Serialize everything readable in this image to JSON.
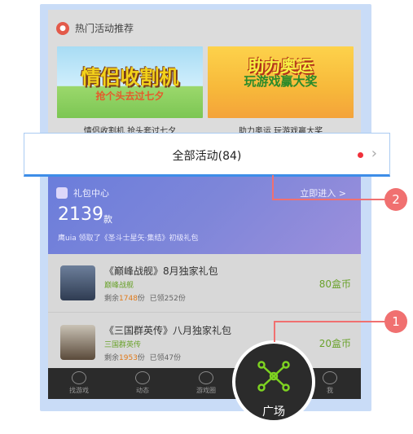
{
  "hot": {
    "title": "热门活动推荐",
    "banners": [
      {
        "art_title": "情侣收割机",
        "art_sub": "抢个头去过七夕",
        "caption": "情侣收割机 抢头套过七夕"
      },
      {
        "art_title": "助力奥运",
        "art_sub": "玩游戏赢大奖",
        "caption": "助力奥运 玩游戏赢大奖"
      }
    ]
  },
  "overlay": {
    "label": "全部活动(84)"
  },
  "gift": {
    "title": "礼包中心",
    "enter_label": "立即进入 >",
    "count": "2139",
    "unit": "款",
    "note": "鹰uia 领取了《圣斗士星矢·集结》初级礼包"
  },
  "games": [
    {
      "title": "《巅峰战舰》8月独家礼包",
      "name": "巅峰战舰",
      "remain_prefix": "剩余",
      "remain": "1748",
      "remain_suffix": "份",
      "claimed": "已领252份",
      "price": "80盒币"
    },
    {
      "title": "《三国群英传》八月独家礼包",
      "name": "三国群英传",
      "remain_prefix": "剩余",
      "remain": "1953",
      "remain_suffix": "份",
      "claimed": "已领47份",
      "price": "20盒币"
    }
  ],
  "nav": {
    "items": [
      {
        "label": "找游戏"
      },
      {
        "label": "动态"
      },
      {
        "label": "游戏圈"
      },
      {
        "label": "广场"
      },
      {
        "label": "我"
      }
    ]
  },
  "callouts": {
    "one": "1",
    "two": "2"
  },
  "colors": {
    "accent": "#3d8de8",
    "callout": "#f07070",
    "price": "#6aa22c",
    "nav_bg": "#2b2b2b"
  }
}
